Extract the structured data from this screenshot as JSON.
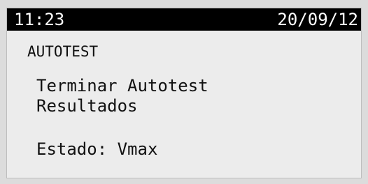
{
  "status_bar": {
    "time": "11:23",
    "date": "20/09/12"
  },
  "screen": {
    "title": "AUTOTEST",
    "menu_items": [
      {
        "label": "Terminar Autotest"
      },
      {
        "label": "Resultados"
      }
    ],
    "status_text": "Estado: Vmax"
  },
  "colors": {
    "status_bar_bg": "#000000",
    "status_bar_text": "#ffffff",
    "screen_bg": "#ececec",
    "text": "#111111"
  }
}
